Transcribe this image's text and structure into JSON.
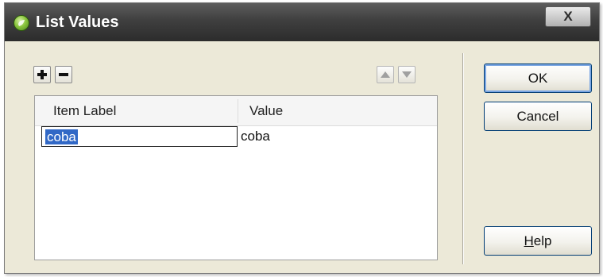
{
  "window": {
    "title": "List Values",
    "close_label": "X"
  },
  "toolbar": {
    "add_label": "+",
    "remove_label": "−",
    "move_up_icon": "triangle-up-icon",
    "move_down_icon": "triangle-down-icon"
  },
  "list": {
    "columns": [
      "Item Label",
      "Value"
    ],
    "rows": [
      {
        "label": "coba",
        "value": "coba"
      }
    ]
  },
  "buttons": {
    "ok": "OK",
    "cancel": "Cancel",
    "help": "Help"
  },
  "colors": {
    "selection": "#3168c6",
    "title_bar": "#3f3f3f",
    "dialog_face": "#ece9d8"
  }
}
